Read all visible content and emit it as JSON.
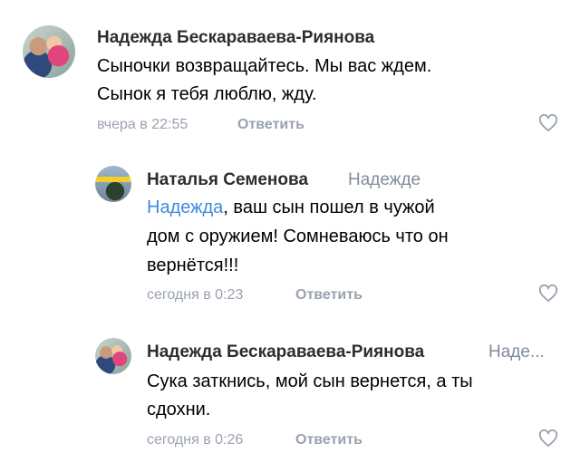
{
  "comments": [
    {
      "author": "Надежда Бескараваева-Риянова",
      "reply_to": "",
      "mention": "",
      "lines": [
        "Сыночки возвращайтесь. Мы вас ждем.",
        "Сынок я тебя люблю, жду."
      ],
      "time": "вчера в 22:55",
      "reply_label": "Ответить",
      "avatar_icon": "user-photo-avatar",
      "like_icon": "heart-outline-icon"
    },
    {
      "author": "Наталья Семенова",
      "reply_to": "Надежде",
      "mention": "Надежда",
      "lines": [
        ", ваш сын пошел в чужой",
        "дом с оружием! Сомневаюсь что он",
        "вернётся!!!"
      ],
      "time": "сегодня в 0:23",
      "reply_label": "Ответить",
      "avatar_icon": "user-photo-avatar",
      "like_icon": "heart-outline-icon"
    },
    {
      "author": "Надежда Бескараваева-Риянова",
      "reply_to": "Наде...",
      "mention": "",
      "lines": [
        "Сука заткнись, мой сын вернется, а ты",
        "сдохни."
      ],
      "time": "сегодня в 0:26",
      "reply_label": "Ответить",
      "avatar_icon": "user-photo-avatar",
      "like_icon": "heart-outline-icon"
    }
  ],
  "colors": {
    "name": "#2c2d2e",
    "secondary": "#99a2ad",
    "mention": "#3f8ae0"
  }
}
